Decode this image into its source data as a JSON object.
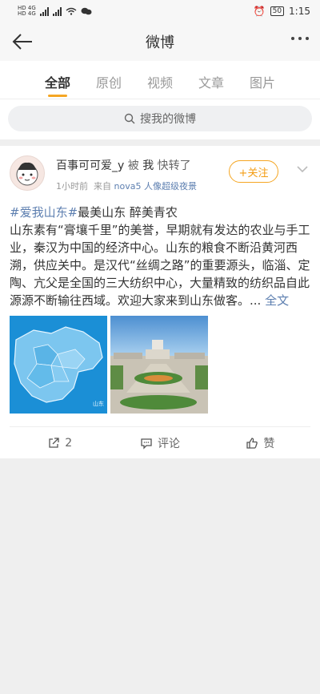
{
  "status_bar": {
    "net1": "HD 4G",
    "net2": "HD 4G",
    "battery": "50",
    "time": "1:15"
  },
  "header": {
    "title": "微博",
    "back_icon": "back-arrow-icon",
    "more_icon": "more-dots-icon"
  },
  "tabs": [
    {
      "label": "全部",
      "active": true
    },
    {
      "label": "原创",
      "active": false
    },
    {
      "label": "视频",
      "active": false
    },
    {
      "label": "文章",
      "active": false
    },
    {
      "label": "图片",
      "active": false
    }
  ],
  "search": {
    "placeholder": "搜我的微博"
  },
  "post": {
    "author": "百事可可爱_y",
    "by_label": "被",
    "me_label": "我",
    "action_label": "快转了",
    "time": "1小时前",
    "source_prefix": "来自",
    "source_device": "nova5 人像超级夜景",
    "follow_label": "+关注",
    "hashtag": "#爱我山东#",
    "title_rest": "最美山东 醉美青农",
    "content": "山东素有“膏壤千里”的美誉，早期就有发达的农业与手工业，秦汉为中国的经济中心。山东的粮食不断沿黄河西溯，供应关中。是汉代“丝绸之路”的重要源头，临淄、定陶、亢父是全国的三大纺织中心，大量精致的纺织品自此源源不断输往西域。欢迎大家来到山东做客。...",
    "full_text_label": "全文",
    "images": [
      {
        "kind": "map",
        "caption": "山东"
      },
      {
        "kind": "plaza"
      }
    ]
  },
  "actions": {
    "repost_count": "2",
    "comment_label": "评论",
    "like_label": "赞"
  },
  "colors": {
    "accent": "#f5a623",
    "link": "#5d7fb0"
  }
}
